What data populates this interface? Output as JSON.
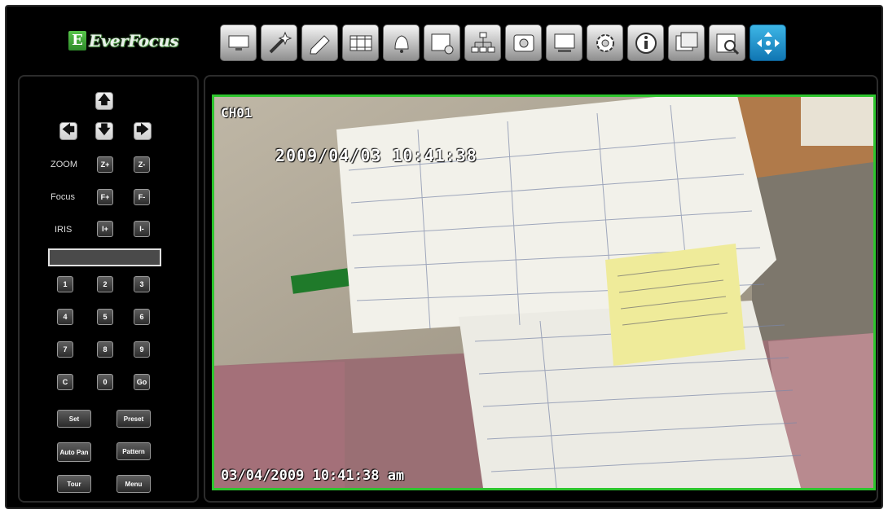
{
  "brand": {
    "logo_text": "EverFocus",
    "logo_mark": "E"
  },
  "toolbar": {
    "buttons": [
      {
        "icon": "live-view-icon"
      },
      {
        "icon": "setup-wand-icon"
      },
      {
        "icon": "edit-icon"
      },
      {
        "icon": "playback-film-icon"
      },
      {
        "icon": "alarm-bell-icon"
      },
      {
        "icon": "schedule-icon"
      },
      {
        "icon": "network-icon"
      },
      {
        "icon": "disk-icon"
      },
      {
        "icon": "display-icon"
      },
      {
        "icon": "gear-icon"
      },
      {
        "icon": "info-icon"
      },
      {
        "icon": "layout-icon"
      },
      {
        "icon": "search-icon"
      },
      {
        "icon": "ptz-icon",
        "active": true
      }
    ]
  },
  "ptz": {
    "arrows": {
      "up": "🡅",
      "down": "🡇",
      "left": "🡄",
      "right": "🡆"
    },
    "zoom": {
      "label": "ZOOM",
      "in": "Z+",
      "out": "Z-"
    },
    "focus": {
      "label": "Focus",
      "in": "F+",
      "out": "F-"
    },
    "iris": {
      "label": "IRIS",
      "in": "I+",
      "out": "I-"
    },
    "preset_value": "",
    "keypad": [
      "1",
      "2",
      "3",
      "4",
      "5",
      "6",
      "7",
      "8",
      "9",
      "C",
      "0",
      "Go"
    ],
    "buttons": {
      "set": "Set",
      "preset": "Preset",
      "auto_pan": "Auto Pan",
      "pattern": "Pattern",
      "tour": "Tour",
      "menu": "Menu"
    }
  },
  "video": {
    "channel": "CH01",
    "camera_timestamp": "2009/04/03 10:41:38",
    "dvr_timestamp": "03/04/2009  10:41:38 am"
  },
  "colors": {
    "accent_active": "#1f8fd0",
    "video_border": "#2ec52e",
    "background": "#000000"
  }
}
